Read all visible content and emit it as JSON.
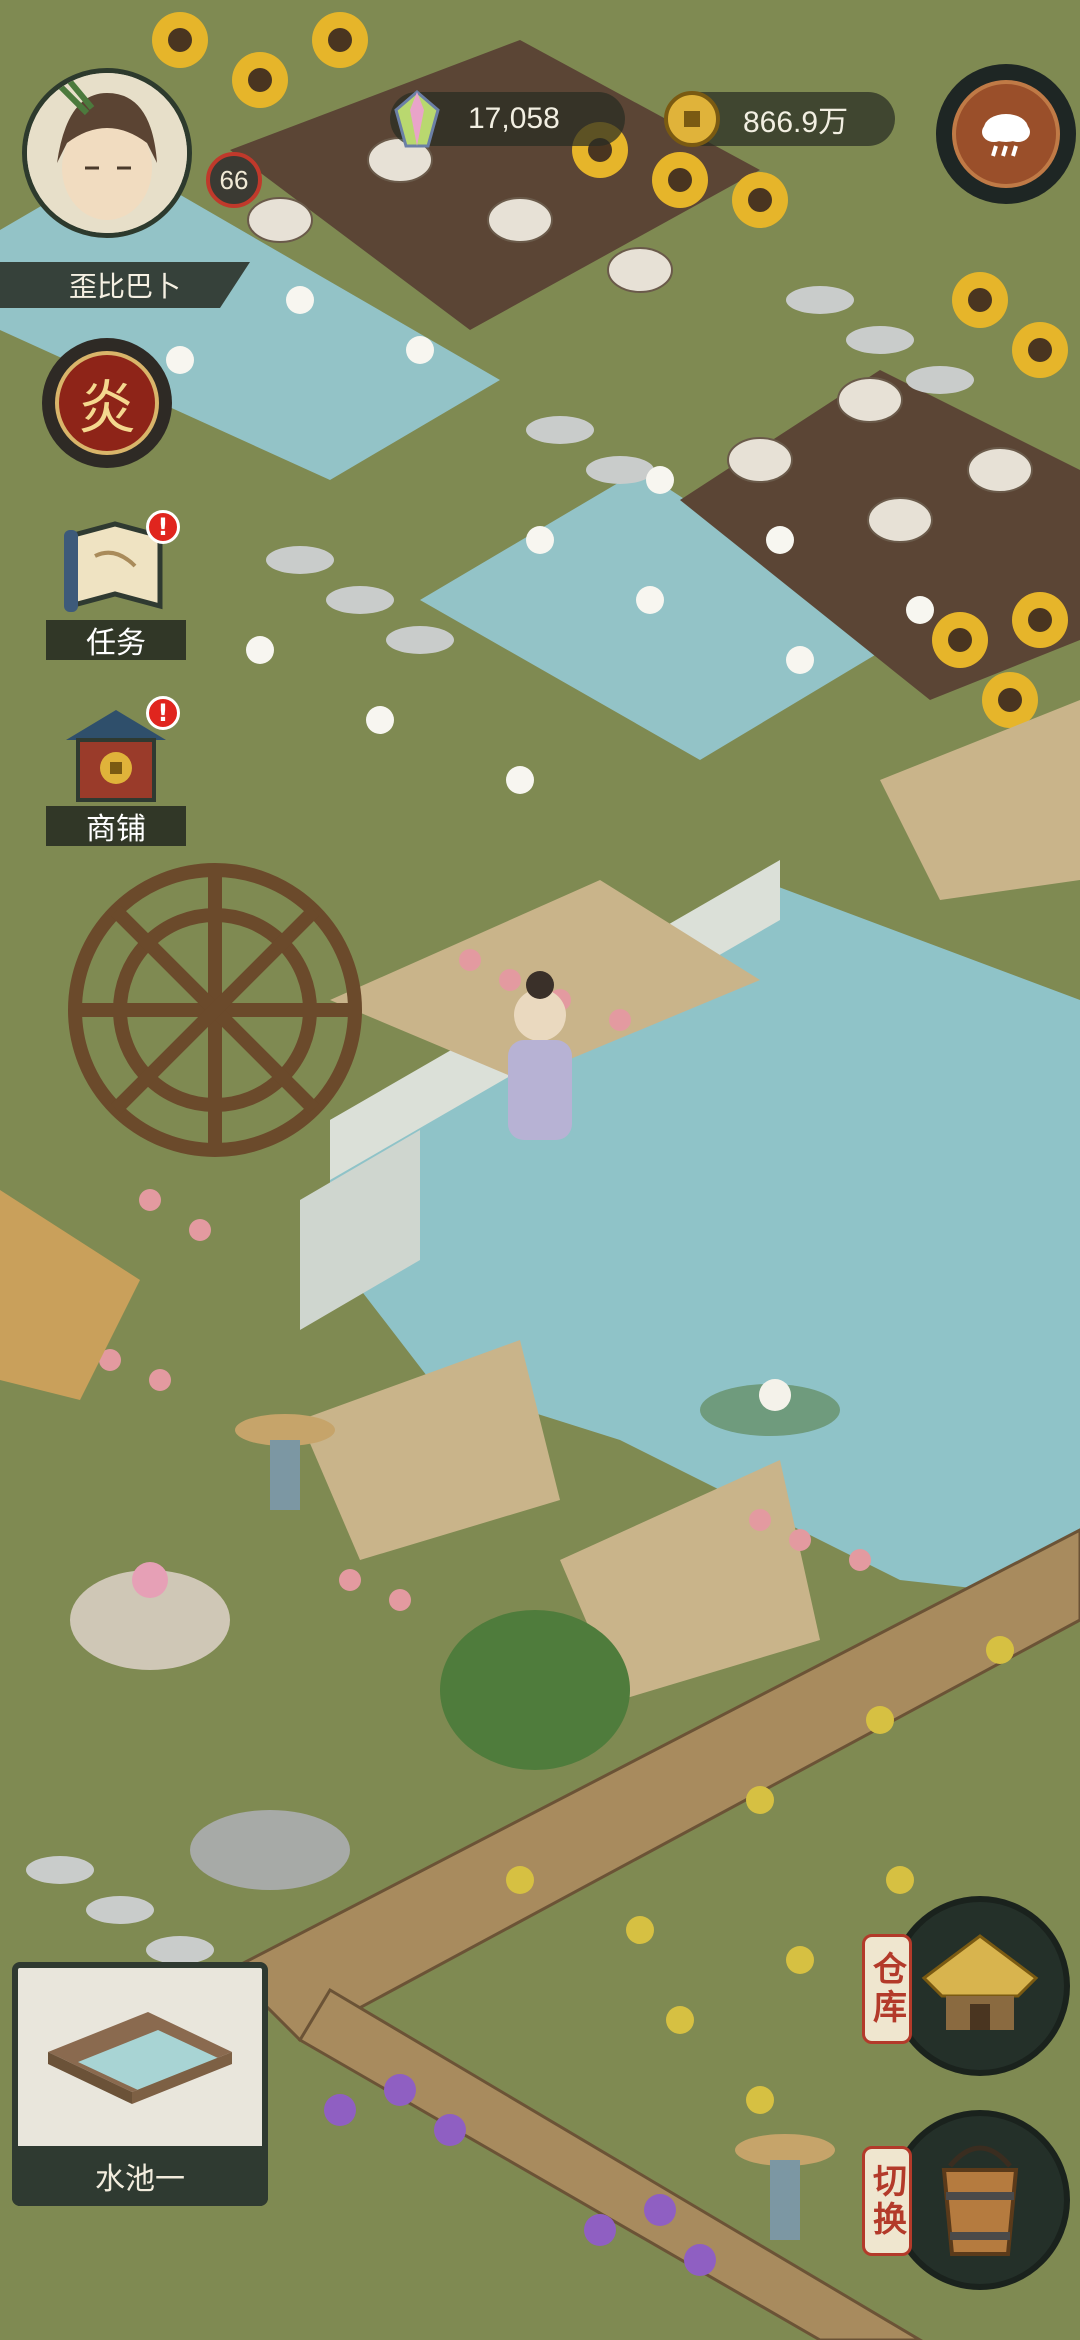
{
  "player": {
    "name": "歪比巴卜",
    "level": "66"
  },
  "currency": {
    "gems": "17,058",
    "coins": "866.9万"
  },
  "side_menu": {
    "fire_glyph": "炎",
    "tasks_label": "任务",
    "shop_label": "商铺"
  },
  "weather": {
    "icon": "cloud-rain-icon"
  },
  "selected_item": {
    "label": "水池一"
  },
  "actions": {
    "storage_label": "仓库",
    "switch_label": "切换"
  },
  "colors": {
    "grass": "#7f8a52",
    "water": "#8fc3c8",
    "soil": "#5c4636",
    "hud_dark": "#2f3a31",
    "accent_red": "#b33a2a"
  }
}
